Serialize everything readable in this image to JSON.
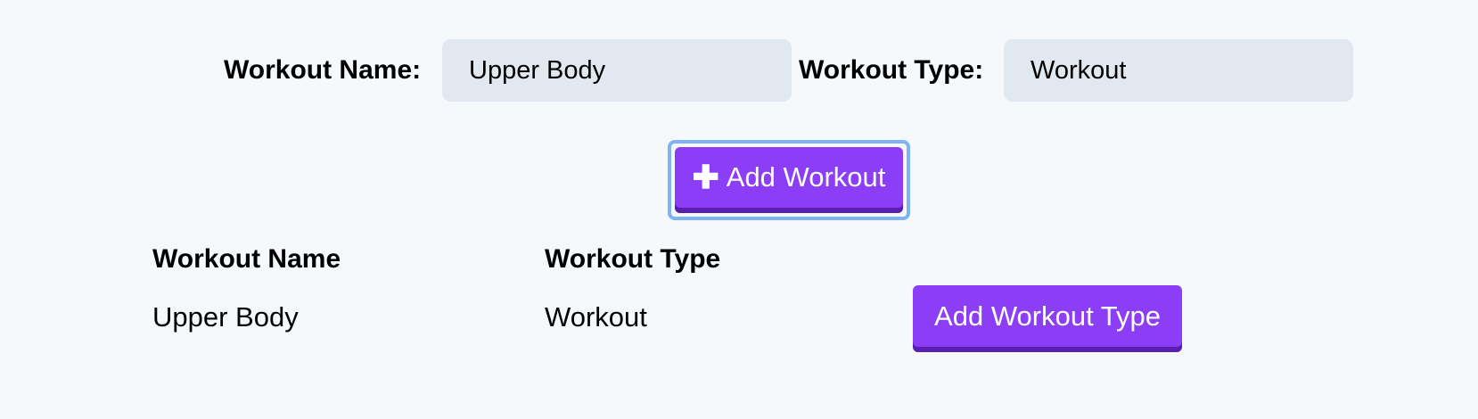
{
  "form": {
    "name_label": "Workout Name:",
    "name_value": "Upper Body",
    "type_label": "Workout Type:",
    "type_value": "Workout",
    "add_button": {
      "icon": "plus-icon",
      "icon_glyph": "✚",
      "label": "Add Workout"
    }
  },
  "table": {
    "headers": [
      "Workout Name",
      "Workout Type"
    ],
    "rows": [
      {
        "name": "Upper Body",
        "type": "Workout",
        "action_label": "Add Workout Type"
      }
    ]
  },
  "colors": {
    "background": "#f5f9fc",
    "input_background": "#e2e8f0",
    "button": "#8b3ef5",
    "button_shadow": "#5a1fb0",
    "focus_ring": "#7fb3f5"
  }
}
